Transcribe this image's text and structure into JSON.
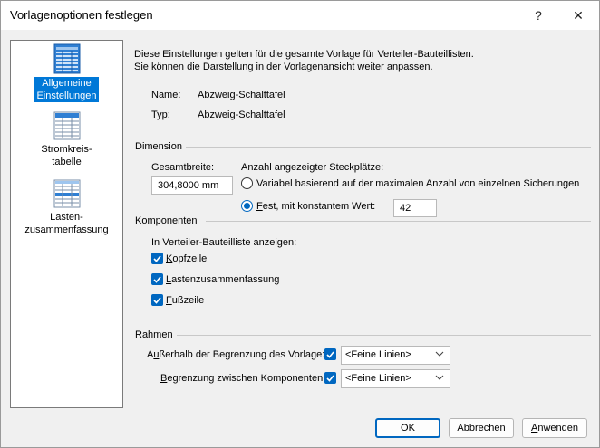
{
  "dialog": {
    "title": "Vorlagenoptionen festlegen",
    "help_glyph": "?",
    "close_glyph": "✕"
  },
  "sidebar": {
    "items": [
      {
        "line1": "Allgemeine",
        "line2": "Einstellungen",
        "selected": true
      },
      {
        "line1": "Stromkreis-",
        "line2": "tabelle",
        "selected": false
      },
      {
        "line1": "Lasten-",
        "line2": "zusammenfassung",
        "selected": false
      }
    ]
  },
  "description": {
    "line1": "Diese Einstellungen gelten für die gesamte Vorlage für Verteiler-Bauteillisten.",
    "line2": "Sie können die Darstellung in der Vorlagenansicht weiter anpassen."
  },
  "info": {
    "name_label": "Name:",
    "name_value": "Abzweig-Schalttafel",
    "type_label": "Typ:",
    "type_value": "Abzweig-Schalttafel"
  },
  "dimension": {
    "title": "Dimension",
    "width_label": "Gesamtbreite:",
    "width_value": "304,8000 mm",
    "slots_label": "Anzahl angezeigter Steckplätze:",
    "option_variable": "Variabel basierend auf der maximalen Anzahl von einzelnen Sicherungen",
    "option_fixed_underlined": "F",
    "option_fixed_rest": "est, mit konstantem Wert:",
    "fixed_value": "42",
    "selected_option": "fixed"
  },
  "components": {
    "title": "Komponenten",
    "show_label": "In Verteiler-Bauteilliste anzeigen:",
    "header_ul": "K",
    "header_rest": "opfzeile",
    "load_ul": "L",
    "load_rest": "astenzusammenfassung",
    "footer_ul": "F",
    "footer_rest": "ußzeile"
  },
  "frame": {
    "title": "Rahmen",
    "outside_pre": "A",
    "outside_ul": "u",
    "outside_rest": "ßerhalb der Begrenzung des Vorlage:",
    "outside_value": "<Feine Linien>",
    "between_ul": "B",
    "between_rest": "egrenzung zwischen Komponenten:",
    "between_value": "<Feine Linien>"
  },
  "buttons": {
    "ok": "OK",
    "cancel": "Abbrechen",
    "apply_ul": "A",
    "apply_rest": "nwenden"
  },
  "colors": {
    "accent": "#0067c0",
    "selection": "#0078d7",
    "icon_blue": "#2f7fd3"
  }
}
